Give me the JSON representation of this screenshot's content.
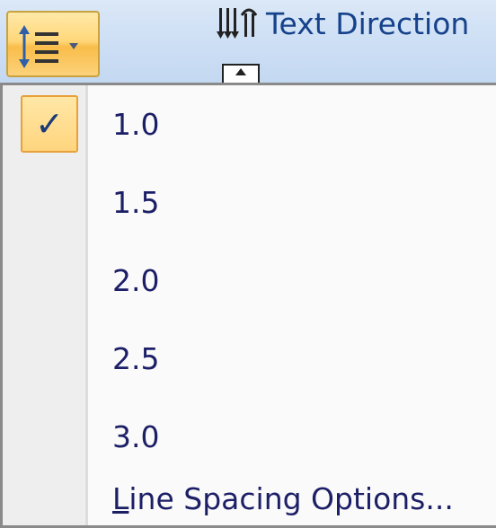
{
  "ribbon": {
    "line_spacing_button": {
      "icon": "line-spacing-icon"
    },
    "text_direction": {
      "label": "Text Direction",
      "icon": "text-direction-icon"
    }
  },
  "menu": {
    "items": [
      {
        "label": "1.0",
        "checked": true
      },
      {
        "label": "1.5",
        "checked": false
      },
      {
        "label": "2.0",
        "checked": false
      },
      {
        "label": "2.5",
        "checked": false
      },
      {
        "label": "3.0",
        "checked": false
      }
    ],
    "options": {
      "label_accel": "L",
      "label_rest": "ine Spacing Options..."
    },
    "check_glyph": "✓"
  },
  "colors": {
    "menu_text": "#1c1f66",
    "ribbon_text": "#15428b",
    "highlight_border": "#e8a13a"
  }
}
